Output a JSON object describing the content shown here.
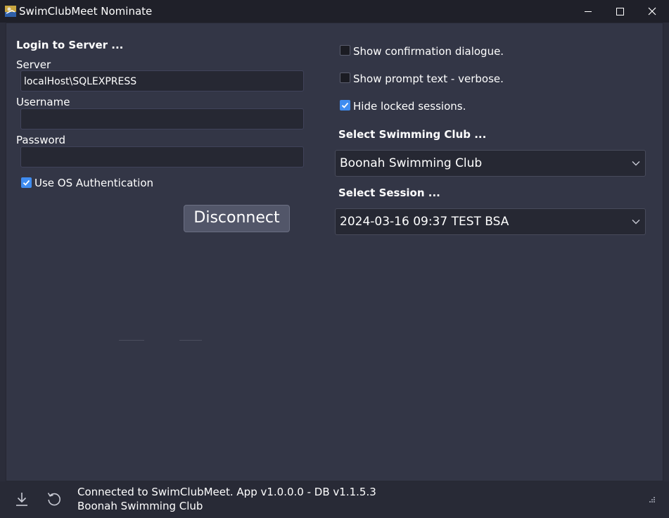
{
  "window": {
    "title": "SwimClubMeet Nominate",
    "icon": "swimmer-app-icon",
    "controls": [
      "minimize-icon",
      "maximize-icon",
      "close-icon"
    ]
  },
  "login": {
    "heading": "Login to Server ...",
    "server_label": "Server",
    "server_value": "localHost\\SQLEXPRESS",
    "username_label": "Username",
    "username_value": "",
    "password_label": "Password",
    "password_value": "",
    "os_auth_label": "Use OS Authentication",
    "os_auth_checked": true,
    "disconnect_label": "Disconnect"
  },
  "options": {
    "show_confirmation": {
      "label": "Show confirmation dialogue.",
      "checked": false
    },
    "show_prompt": {
      "label": "Show prompt text - verbose.",
      "checked": false
    },
    "hide_locked": {
      "label": "Hide locked sessions.",
      "checked": true
    }
  },
  "club": {
    "heading": "Select Swimming Club ...",
    "selected": "Boonah Swimming Club"
  },
  "session": {
    "heading": "Select Session ...",
    "selected": "2024-03-16 09:37 TEST BSA"
  },
  "status": {
    "line1": "Connected to SwimClubMeet. App v1.0.0.0 - DB v1.1.5.3",
    "line2": "Boonah Swimming Club",
    "icons": [
      "download-icon",
      "refresh-icon",
      "resize-grip-icon"
    ]
  },
  "colors": {
    "accent": "#3f8cf0",
    "window_bg": "#333646",
    "titlebar_bg": "#1f2029",
    "field_bg": "#262833"
  }
}
